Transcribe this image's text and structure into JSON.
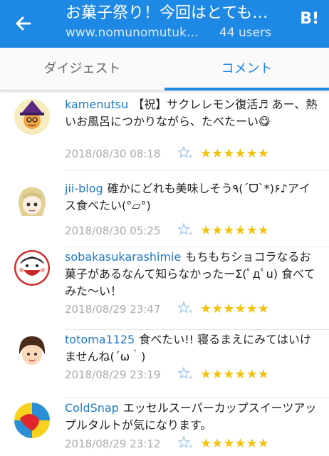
{
  "header": {
    "title": "お菓子祭り！今回はとても…",
    "url": "www.nomunomutuk…",
    "users": "44 users",
    "hatena_label": "B!"
  },
  "tabs": [
    {
      "label": "ダイジェスト",
      "active": false
    },
    {
      "label": "コメント",
      "active": true
    }
  ],
  "comments": [
    {
      "user": "kamenutsu",
      "text": "【祝】サクレレモン復活♬ あー、熱いお風呂につかりながら、たべたーい😋",
      "date": "2018/08/30 08:18",
      "stars": "★★★★★★",
      "avatar_icon": "witch-avatar-icon"
    },
    {
      "user": "jii-blog",
      "text": "確かにどれも美味しそう٩(´ᗜ`*)۶♪アイス食べたい(°▱°)",
      "date": "2018/08/30 05:25",
      "stars": "★★★★★★",
      "avatar_icon": "blonde-avatar-icon"
    },
    {
      "user": "sobakasukarashimie",
      "text": "もちもちショコラなるお菓子があるなんて知らなかったーΣ(ﾟдﾟu) 食べてみた〜い！",
      "date": "2018/08/29 23:47",
      "stars": "★★★★★★",
      "avatar_icon": "smiling-face-avatar-icon"
    },
    {
      "user": "totoma1125",
      "text": "食べたい!! 寝るまえにみてはいけませんね(´ω｀)",
      "date": "2018/08/29 23:19",
      "stars": "★★★★★★",
      "avatar_icon": "child-avatar-icon"
    },
    {
      "user": "ColdSnap",
      "text": "エッセルスーパーカップスイーツアップルタルトが気になります。",
      "date": "2018/08/29 23:12",
      "stars": "★★★★★★",
      "avatar_icon": "colorful-logo-avatar-icon"
    }
  ],
  "colors": {
    "accent": "#1e88e5",
    "star": "#f4c20d",
    "username": "#1e7ac8"
  }
}
